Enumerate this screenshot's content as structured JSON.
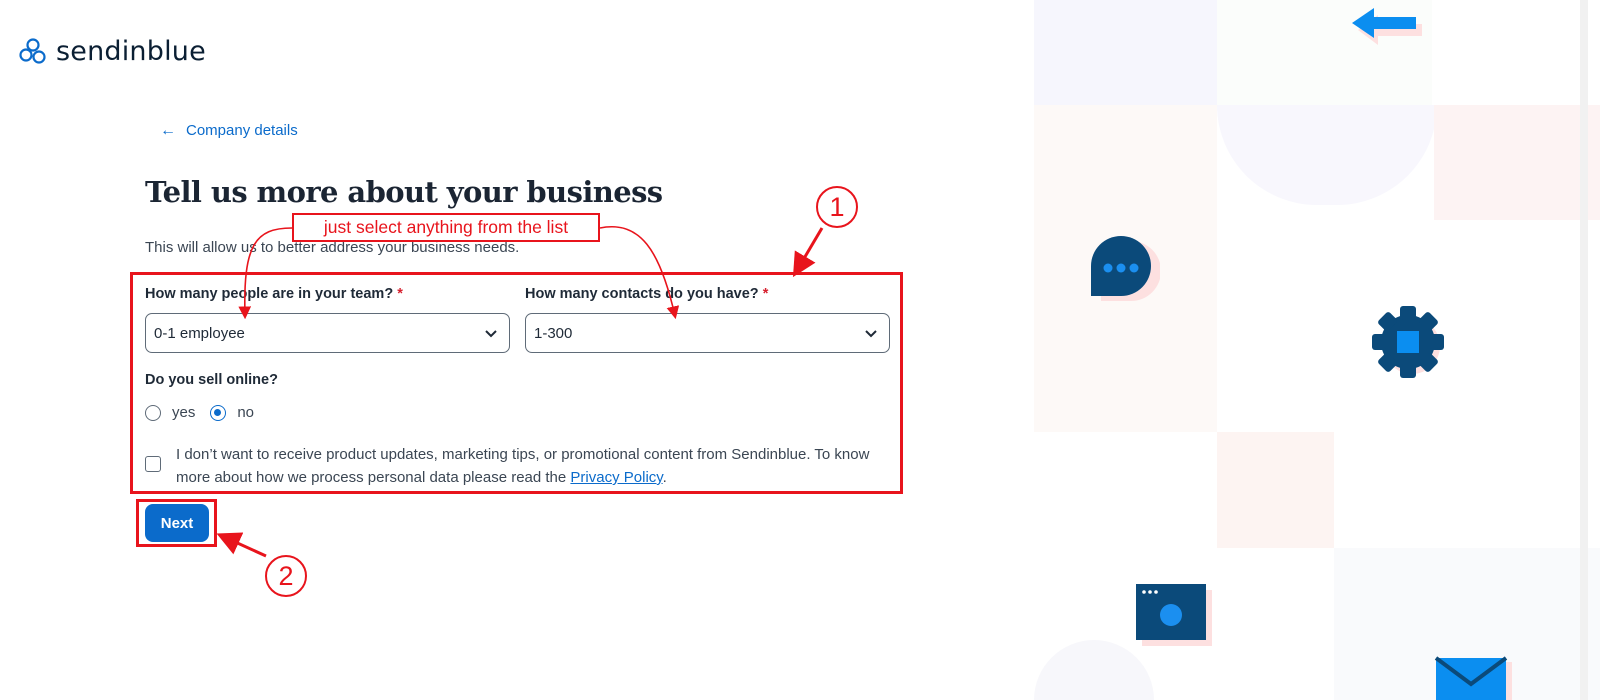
{
  "brand": {
    "name": "sendinblue",
    "color": "#0b6bcb"
  },
  "back_link": {
    "label": "Company details"
  },
  "page": {
    "title": "Tell us more about your business",
    "subtitle": "This will allow us to better address your business needs."
  },
  "form": {
    "team_size": {
      "label": "How many people are in your team?",
      "required_mark": "*",
      "value": "0-1 employee"
    },
    "contacts": {
      "label": "How many contacts do you have?",
      "required_mark": "*",
      "value": "1-300"
    },
    "sell_online": {
      "label": "Do you sell online?",
      "options": [
        {
          "label": "yes",
          "checked": false
        },
        {
          "label": "no",
          "checked": true
        }
      ]
    },
    "consent": {
      "text": "I don’t want to receive product updates, marketing tips, or promotional content from Sendinblue. To know more about how we process personal data please read the ",
      "link": "Privacy Policy",
      "suffix": ".",
      "checked": false
    },
    "next_label": "Next"
  },
  "annotations": {
    "note": "just select anything from the list",
    "step1": "1",
    "step2": "2",
    "color": "#e8141c"
  }
}
